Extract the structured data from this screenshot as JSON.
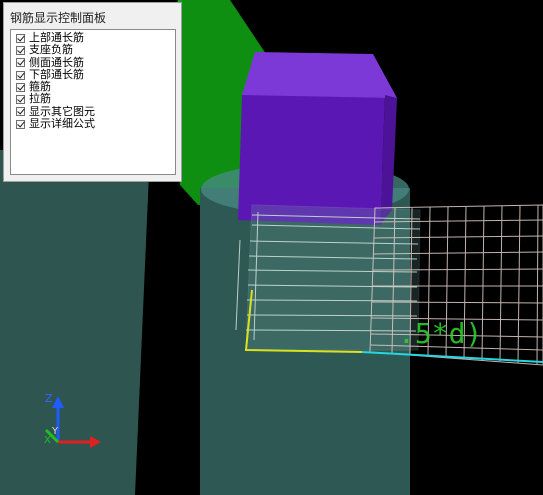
{
  "panel": {
    "title": "钢筋显示控制面板",
    "options": [
      {
        "label": "上部通长筋",
        "checked": true
      },
      {
        "label": "支座负筋",
        "checked": true
      },
      {
        "label": "侧面通长筋",
        "checked": true
      },
      {
        "label": "下部通长筋",
        "checked": true
      },
      {
        "label": "箍筋",
        "checked": true
      },
      {
        "label": "拉筋",
        "checked": true
      },
      {
        "label": "显示其它图元",
        "checked": true
      },
      {
        "label": "显示详细公式",
        "checked": true
      }
    ]
  },
  "viewport": {
    "annotation": ".5*d)",
    "axis": {
      "z": "Z",
      "y": "Y",
      "x": "X"
    }
  },
  "colors": {
    "background": "#000000",
    "column": "#2f5551",
    "green_beam": "#0f8f12",
    "purple_block": "#6a20c4",
    "rebar_cage": "#d7c8c0",
    "annotation": "#2ccf2c",
    "highlight_yellow": "#d9e21f",
    "highlight_cyan": "#26d6e0"
  }
}
